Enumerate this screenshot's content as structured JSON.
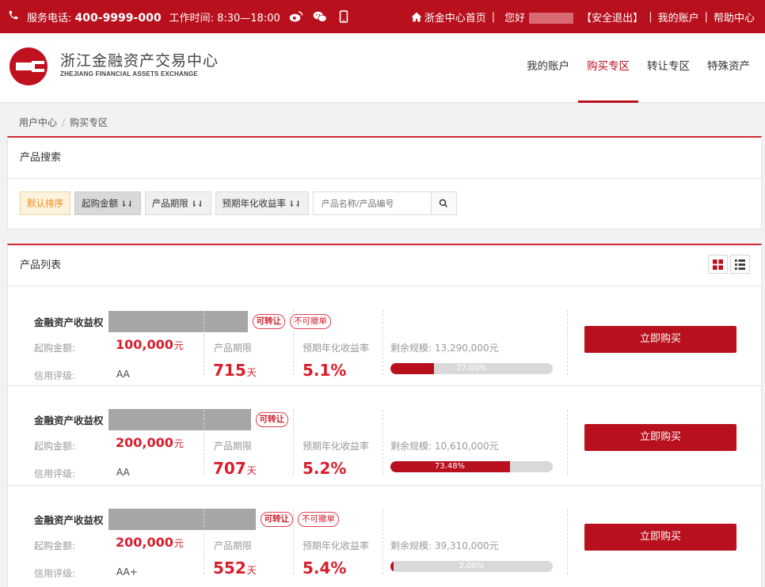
{
  "topbar": {
    "phone_label": "服务电话:",
    "phone": "400-9999-000",
    "hours": "工作时间: 8:30—18:00",
    "icons": [
      "phone-icon",
      "weibo-icon",
      "wechat-icon",
      "mobile-icon",
      "home-icon"
    ],
    "home_link": "浙金中心首页",
    "greeting": "您好",
    "logout": "【安全退出】",
    "my_account": "我的账户",
    "help": "帮助中心",
    "separator": "|"
  },
  "header": {
    "logo_cn": "浙江金融资产交易中心",
    "logo_en": "ZHEJIANG FINANCIAL ASSETS EXCHANGE",
    "nav": [
      {
        "label": "我的账户",
        "active": false
      },
      {
        "label": "购买专区",
        "active": true
      },
      {
        "label": "转让专区",
        "active": false
      },
      {
        "label": "特殊资产",
        "active": false
      }
    ],
    "brand_color": "#b8101d"
  },
  "breadcrumb": {
    "items": [
      "用户中心",
      "购买专区"
    ],
    "separator": "/"
  },
  "search": {
    "title": "产品搜索",
    "sort_buttons": [
      {
        "label": "默认排序"
      },
      {
        "label": "起购金额"
      },
      {
        "label": "产品期限"
      },
      {
        "label": "预期年化收益率"
      }
    ],
    "sort_arrow": "⇂",
    "placeholder": "产品名称/产品编号"
  },
  "list": {
    "title": "产品列表",
    "labels": {
      "min_amount": "起购金额:",
      "rating": "信用评级:",
      "term": "产品期限",
      "yield": "预期年化收益率",
      "remaining": "剩余规模:",
      "buy": "立即购买"
    },
    "products": [
      {
        "name": "金融资产收益权",
        "tags": [
          "可转让",
          "不可撤单"
        ],
        "min_amount": "100,000",
        "amount_unit": "元",
        "rating": "AA",
        "term": "715",
        "term_unit": "天",
        "yield": "5.1%",
        "remaining": "13,290,000元",
        "progress_pct": 27.0,
        "progress_label": "27.00%"
      },
      {
        "name": "金融资产收益权",
        "tags": [
          "可转让"
        ],
        "min_amount": "200,000",
        "amount_unit": "元",
        "rating": "AA",
        "term": "707",
        "term_unit": "天",
        "yield": "5.2%",
        "remaining": "10,610,000元",
        "progress_pct": 73.48,
        "progress_label": "73.48%"
      },
      {
        "name": "金融资产收益权",
        "tags": [
          "可转让",
          "不可撤单"
        ],
        "min_amount": "200,000",
        "amount_unit": "元",
        "rating": "AA+",
        "term": "552",
        "term_unit": "天",
        "yield": "5.4%",
        "remaining": "39,310,000元",
        "progress_pct": 2.0,
        "progress_label": "2.00%"
      }
    ]
  }
}
